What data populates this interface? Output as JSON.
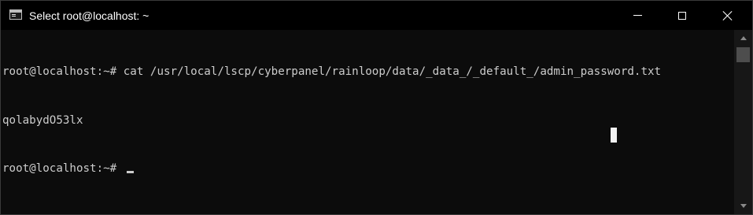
{
  "window": {
    "title": "Select root@localhost: ~",
    "icon": "console-icon",
    "controls": {
      "minimize": "minimize-icon",
      "maximize": "maximize-icon",
      "close": "close-icon"
    }
  },
  "terminal": {
    "lines": [
      "root@localhost:~# cat /usr/local/lscp/cyberpanel/rainloop/data/_data_/_default_/admin_password.txt",
      "qolabydO53lx",
      "root@localhost:~# "
    ],
    "foreground": "#cccccc",
    "background": "#0c0c0c"
  },
  "scrollbar": {
    "up_icon": "scroll-up-arrow-icon",
    "down_icon": "scroll-down-arrow-icon"
  }
}
